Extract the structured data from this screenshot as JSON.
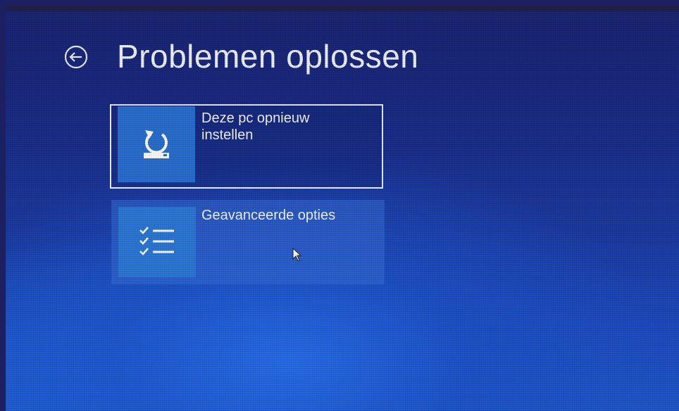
{
  "header": {
    "title": "Problemen oplossen",
    "back_icon": "back-arrow-circle-icon"
  },
  "tiles": [
    {
      "label": "Deze pc opnieuw instellen",
      "icon": "reset-pc-icon",
      "selected": true
    },
    {
      "label": "Geavanceerde opties",
      "icon": "checklist-icon",
      "selected": false
    }
  ],
  "colors": {
    "background_top": "#1b2572",
    "background_bottom": "#2058cc",
    "tile_icon_bg": "#2c78d6",
    "text": "#ffffff"
  }
}
